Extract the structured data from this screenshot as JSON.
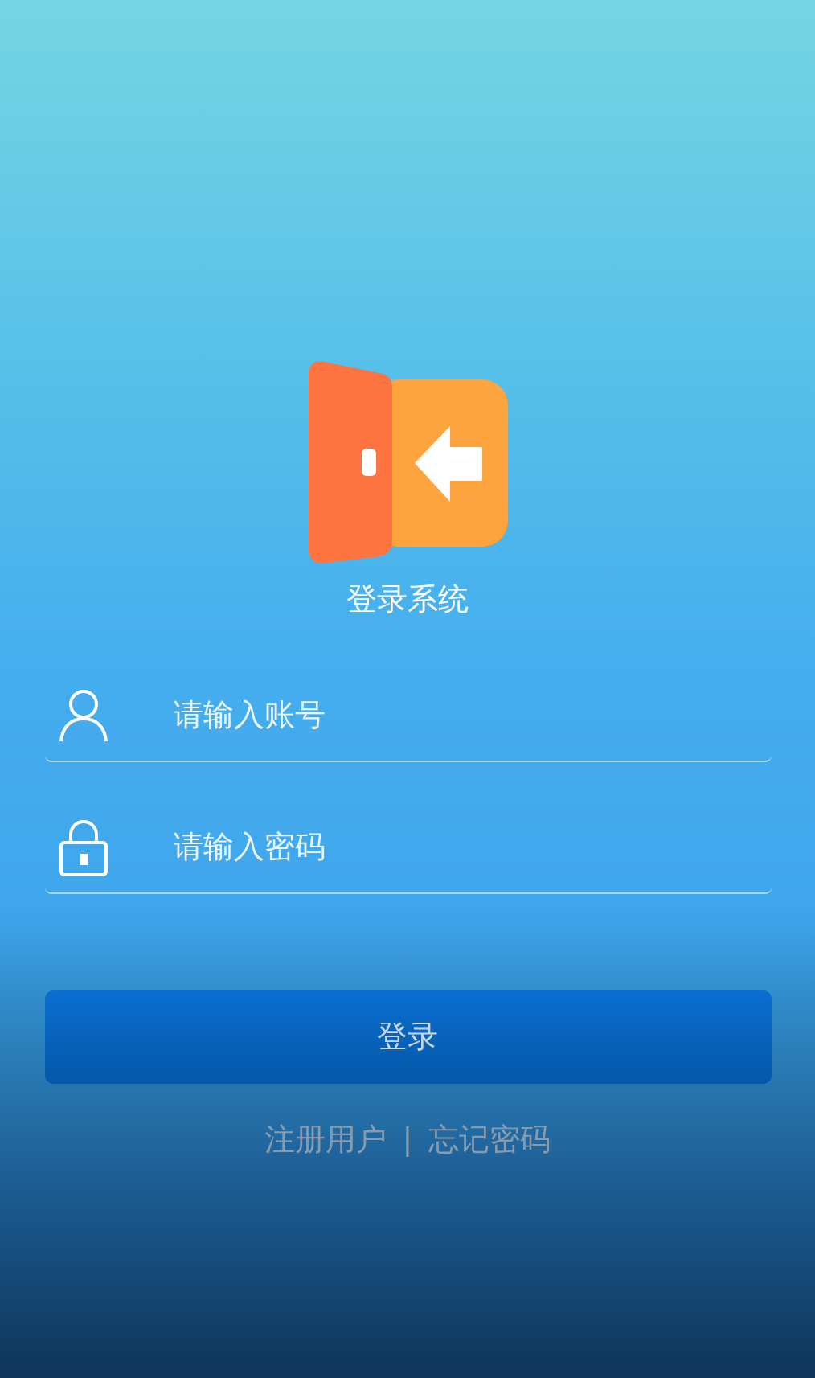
{
  "app_title": "登录系统",
  "fields": [
    {
      "kind": "user",
      "placeholder": "请输入账号"
    },
    {
      "kind": "password",
      "placeholder": "请输入密码"
    }
  ],
  "login_button": "登录",
  "links": [
    {
      "label": "注册用户"
    },
    {
      "label": "忘记密码"
    }
  ],
  "link_separator": "|"
}
